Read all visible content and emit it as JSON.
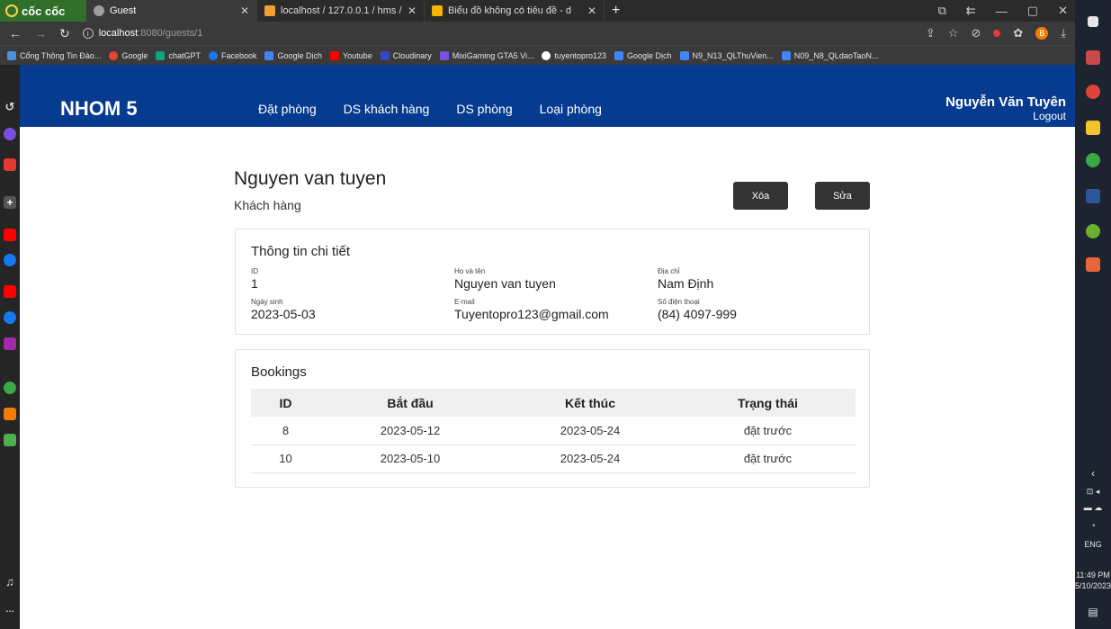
{
  "browser": {
    "brand": "cốc cốc",
    "tabs": [
      {
        "title": "Guest",
        "icon_color": "#9e9e9e",
        "active": true
      },
      {
        "title": "localhost / 127.0.0.1 / hms /",
        "icon_color": "#f0a030",
        "active": false
      },
      {
        "title": "Biểu đồ không có tiêu đề - d",
        "icon_color": "#f4b400",
        "active": false
      }
    ],
    "address": {
      "host": "localhost",
      "path": ":8080/guests/1"
    },
    "bookmarks": [
      {
        "label": "Cổng Thông Tin Đào...",
        "color": "#4a8fe0"
      },
      {
        "label": "Google",
        "color": "#ea4335"
      },
      {
        "label": "chatGPT",
        "color": "#10a37f"
      },
      {
        "label": "Facebook",
        "color": "#1877f2"
      },
      {
        "label": "Google Dịch",
        "color": "#4285f4"
      },
      {
        "label": "Youtube",
        "color": "#ff0000"
      },
      {
        "label": "Cloudinary",
        "color": "#3448c5"
      },
      {
        "label": "MixiGaming GTA5 Vi...",
        "color": "#7b4fe0"
      },
      {
        "label": "tuyentopro123",
        "color": "#ffffff"
      },
      {
        "label": "Google Dịch",
        "color": "#4285f4"
      },
      {
        "label": "N9_N13_QLThuVien...",
        "color": "#4285f4"
      },
      {
        "label": "N09_N8_QLdaoTaoN...",
        "color": "#4285f4"
      }
    ],
    "profile_badge": "B"
  },
  "taskbar": {
    "language": "ENG",
    "time": "11:49 PM",
    "date": "5/10/2023"
  },
  "nav": {
    "brand": "NHOM 5",
    "links": [
      "Đặt phòng",
      "DS khách hàng",
      "DS phòng",
      "Loại phòng"
    ],
    "user_name": "Nguyễn Văn Tuyên",
    "logout": "Logout"
  },
  "guest": {
    "name": "Nguyen van tuyen",
    "role": "Khách hàng",
    "delete_label": "Xóa",
    "edit_label": "Sửa"
  },
  "details": {
    "title": "Thông tin chi tiết",
    "id_label": "ID",
    "id_value": "1",
    "fullname_label": "Họ và tên",
    "fullname_value": "Nguyen van tuyen",
    "address_label": "Địa chỉ",
    "address_value": "Nam Định",
    "dob_label": "Ngày sinh",
    "dob_value": "2023-05-03",
    "email_label": "E-mail",
    "email_value": "Tuyentopro123@gmail.com",
    "phone_label": "Số điện thoại",
    "phone_value": "(84) 4097-999"
  },
  "bookings": {
    "title": "Bookings",
    "headers": [
      "ID",
      "Bắt đầu",
      "Kết thúc",
      "Trạng thái"
    ],
    "rows": [
      [
        "8",
        "2023-05-12",
        "2023-05-24",
        "đặt trước"
      ],
      [
        "10",
        "2023-05-10",
        "2023-05-24",
        "đặt trước"
      ]
    ]
  }
}
